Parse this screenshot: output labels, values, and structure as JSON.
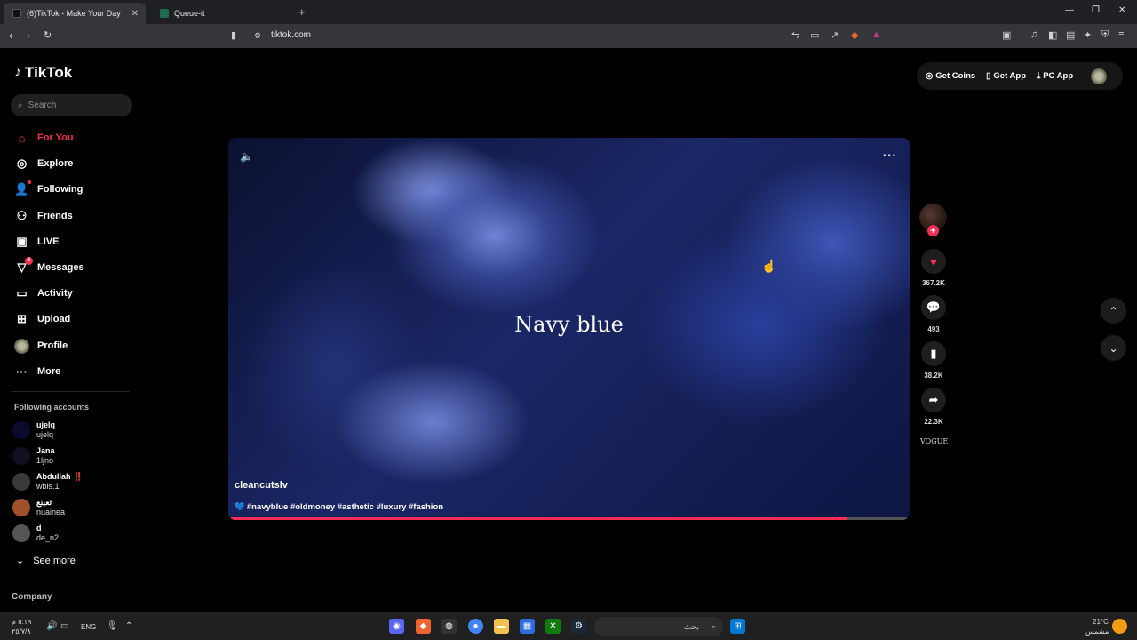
{
  "browser": {
    "tabs": [
      {
        "title": "(6)TikTok - Make Your Day",
        "active": true
      },
      {
        "title": "Queue-it",
        "active": false
      }
    ],
    "url": "tiktok.com"
  },
  "tiktok": {
    "logo_text": "TikTok",
    "search_placeholder": "Search",
    "nav": [
      {
        "label": "For You",
        "icon": "home-icon",
        "active": true
      },
      {
        "label": "Explore",
        "icon": "compass-icon"
      },
      {
        "label": "Following",
        "icon": "following-icon"
      },
      {
        "label": "Friends",
        "icon": "friends-icon"
      },
      {
        "label": "LIVE",
        "icon": "live-icon"
      },
      {
        "label": "Messages",
        "icon": "messages-icon",
        "badge": "6"
      },
      {
        "label": "Activity",
        "icon": "activity-icon"
      },
      {
        "label": "Upload",
        "icon": "upload-icon"
      },
      {
        "label": "Profile",
        "icon": "profile-avatar"
      },
      {
        "label": "More",
        "icon": "more-icon"
      }
    ],
    "following_title": "Following accounts",
    "accounts": [
      {
        "name": "ujelq",
        "handle": "ujelq"
      },
      {
        "name": "Jana",
        "handle": "1ljno"
      },
      {
        "name": "Abdullah ‼️",
        "handle": "wbls.1"
      },
      {
        "name": "تعبنع",
        "handle": "nuainea"
      },
      {
        "name": "d",
        "handle": "de_n2"
      }
    ],
    "see_more": "See more",
    "company": "Company",
    "header": {
      "get_coins": "Get Coins",
      "get_app": "Get App",
      "pc_app": "PC App"
    },
    "video": {
      "overlay_title": "Navy blue",
      "author": "cleancutslv",
      "caption": "#navyblue #oldmoney #asthetic #luxury #fashion",
      "progress": 0.91
    },
    "actions": {
      "likes": "367.2K",
      "comments": "493",
      "saves": "38.2K",
      "shares": "22.3K",
      "sound_label": "VOGUE"
    }
  },
  "taskbar": {
    "lang": "ENG",
    "time": "٥:١٩ م",
    "date": "٢٥/٧/٨",
    "weather_temp": "21°C",
    "weather_desc": "مشمس",
    "search_label": "بحث"
  }
}
